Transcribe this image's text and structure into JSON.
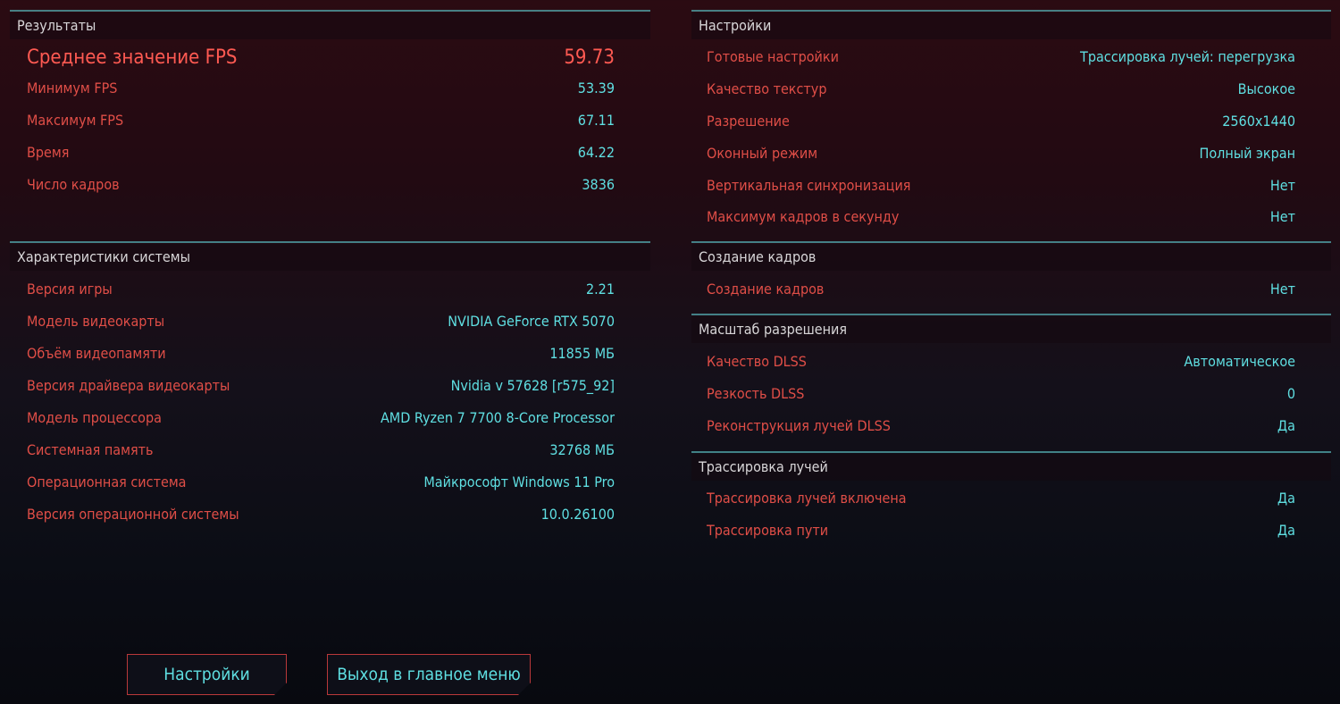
{
  "results": {
    "title": "Результаты",
    "rows": [
      {
        "label": "Среднее значение FPS",
        "value": "59.73"
      },
      {
        "label": "Минимум FPS",
        "value": "53.39"
      },
      {
        "label": "Максимум FPS",
        "value": "67.11"
      },
      {
        "label": "Время",
        "value": "64.22"
      },
      {
        "label": "Число кадров",
        "value": "3836"
      }
    ]
  },
  "system": {
    "title": "Характеристики системы",
    "rows": [
      {
        "label": "Версия игры",
        "value": "2.21"
      },
      {
        "label": "Модель видеокарты",
        "value": "NVIDIA GeForce RTX 5070"
      },
      {
        "label": "Объём видеопамяти",
        "value": "11855 МБ"
      },
      {
        "label": "Версия драйвера видеокарты",
        "value": "Nvidia v 57628 [r575_92]"
      },
      {
        "label": "Модель процессора",
        "value": "AMD Ryzen 7 7700 8-Core Processor"
      },
      {
        "label": "Системная память",
        "value": "32768 МБ"
      },
      {
        "label": "Операционная система",
        "value": "Майкрософт Windows 11 Pro"
      },
      {
        "label": "Версия операционной системы",
        "value": "10.0.26100"
      }
    ]
  },
  "settings": {
    "title": "Настройки",
    "rows": [
      {
        "label": "Готовые настройки",
        "value": "Трассировка лучей: перегрузка"
      },
      {
        "label": "Качество текстур",
        "value": "Высокое"
      },
      {
        "label": "Разрешение",
        "value": "2560x1440"
      },
      {
        "label": "Оконный режим",
        "value": "Полный экран"
      },
      {
        "label": "Вертикальная синхронизация",
        "value": "Нет"
      },
      {
        "label": "Максимум кадров в секунду",
        "value": "Нет"
      }
    ]
  },
  "framegen": {
    "title": "Создание кадров",
    "rows": [
      {
        "label": "Создание кадров",
        "value": "Нет"
      }
    ]
  },
  "scaling": {
    "title": "Масштаб разрешения",
    "rows": [
      {
        "label": "Качество DLSS",
        "value": "Автоматическое"
      },
      {
        "label": "Резкость DLSS",
        "value": "0"
      },
      {
        "label": "Реконструкция лучей DLSS",
        "value": "Да"
      }
    ]
  },
  "raytracing": {
    "title": "Трассировка лучей",
    "rows": [
      {
        "label": "Трассировка лучей включена",
        "value": "Да"
      },
      {
        "label": "Трассировка пути",
        "value": "Да"
      }
    ]
  },
  "buttons": {
    "settings": "Настройки",
    "exit": "Выход в главное меню"
  }
}
